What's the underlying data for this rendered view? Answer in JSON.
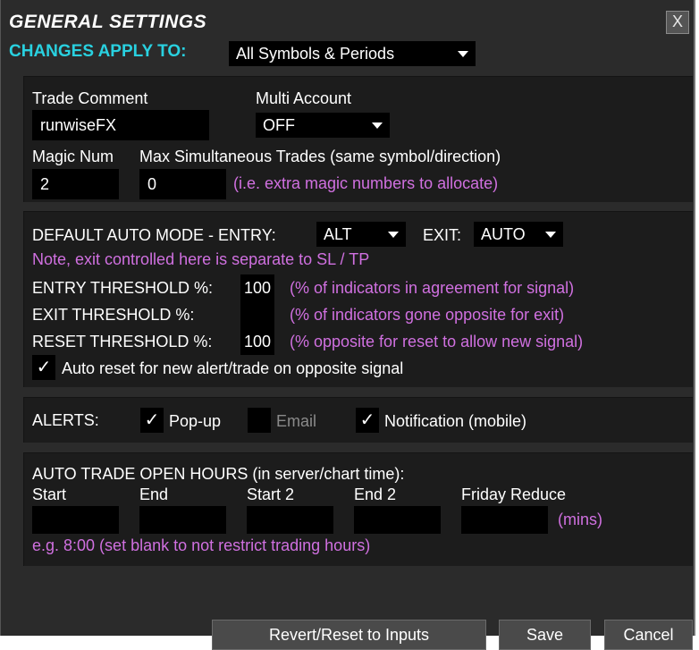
{
  "dialog": {
    "title": "GENERAL SETTINGS",
    "close_label": "X",
    "changes_apply_label": "CHANGES APPLY TO:",
    "changes_apply_value": "All Symbols & Periods"
  },
  "general": {
    "trade_comment_label": "Trade Comment",
    "trade_comment_value": "runwiseFX",
    "multi_account_label": "Multi Account",
    "multi_account_value": "OFF",
    "magic_num_label": "Magic Num",
    "magic_num_value": "2",
    "max_trades_label": "Max Simultaneous Trades (same symbol/direction)",
    "max_trades_value": "0",
    "max_trades_hint": "(i.e. extra magic numbers to allocate)"
  },
  "auto_mode": {
    "label": "DEFAULT AUTO MODE - ENTRY:",
    "entry_value": "ALT",
    "exit_label": "EXIT:",
    "exit_value": "AUTO",
    "note": "Note, exit controlled here is separate to SL / TP",
    "entry_threshold_label": "ENTRY THRESHOLD %:",
    "entry_threshold_value": "100",
    "entry_threshold_hint": "(% of indicators in agreement for signal)",
    "exit_threshold_label": "EXIT THRESHOLD %:",
    "exit_threshold_value": "",
    "exit_threshold_hint": "(% of indicators gone opposite for exit)",
    "reset_threshold_label": "RESET THRESHOLD %:",
    "reset_threshold_value": "100",
    "reset_threshold_hint": "(% opposite for reset to allow new signal)",
    "auto_reset_label": "Auto reset for new alert/trade on opposite signal",
    "auto_reset_checked": true
  },
  "alerts": {
    "label": "ALERTS:",
    "popup_label": "Pop-up",
    "popup_checked": true,
    "email_label": "Email",
    "email_checked": false,
    "notification_label": "Notification (mobile)",
    "notification_checked": true
  },
  "hours": {
    "title": "AUTO TRADE OPEN HOURS (in server/chart time):",
    "start_label": "Start",
    "end_label": "End",
    "start2_label": "Start 2",
    "end2_label": "End 2",
    "friday_label": "Friday Reduce",
    "mins_label": "(mins)",
    "start_value": "",
    "end_value": "",
    "start2_value": "",
    "end2_value": "",
    "friday_value": "",
    "example": "e.g. 8:00 (set blank to not restrict trading hours)"
  },
  "buttons": {
    "revert_label": "Revert/Reset to Inputs",
    "save_label": "Save",
    "cancel_label": "Cancel"
  },
  "checkmark": "✓",
  "colors": {
    "accent_cyan": "#29d1e0",
    "hint_magenta": "#d070e0",
    "panel_bg": "#1c1c1c",
    "dialog_bg": "#2b2b2b"
  }
}
